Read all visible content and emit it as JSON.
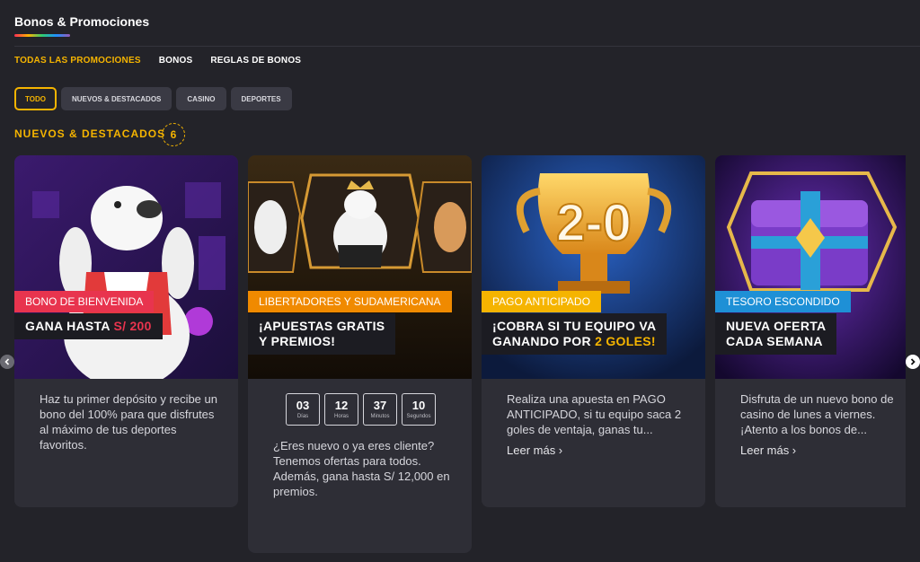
{
  "header": {
    "title": "Bonos & Promociones"
  },
  "tabs": [
    {
      "label": "TODAS LAS PROMOCIONES"
    },
    {
      "label": "BONOS"
    },
    {
      "label": "REGLAS DE BONOS"
    }
  ],
  "filters": [
    {
      "label": "TODO"
    },
    {
      "label": "NUEVOS & DESTACADOS"
    },
    {
      "label": "CASINO"
    },
    {
      "label": "DEPORTES"
    }
  ],
  "section": {
    "heading": "NUEVOS & DESTACADOS",
    "count": "6"
  },
  "cards": [
    {
      "tag": "BONO DE BIENVENIDA",
      "tag_color": "#e8344e",
      "headline_main": "GANA HASTA ",
      "headline_accent": "S/ 200",
      "description": "Haz tu primer depósito y recibe un bono del 100% para que disfrutes al máximo de tus deportes favoritos."
    },
    {
      "tag": "LIBERTADORES Y SUDAMERICANA",
      "tag_color": "#f08a00",
      "headline_line1": "¡APUESTAS GRATIS",
      "headline_line2": "Y PREMIOS!",
      "countdown": [
        {
          "value": "03",
          "label": "Días"
        },
        {
          "value": "12",
          "label": "Horas"
        },
        {
          "value": "37",
          "label": "Minutos"
        },
        {
          "value": "10",
          "label": "Segundos"
        }
      ],
      "description": "¿Eres nuevo o ya eres cliente? Tenemos ofertas para todos. Además, gana hasta S/ 12,000 en premios."
    },
    {
      "tag": "PAGO ANTICIPADO",
      "tag_color": "#f5b400",
      "headline_line1": "¡COBRA SI TU EQUIPO VA",
      "headline_line2_main": "GANANDO POR ",
      "headline_line2_accent": "2 GOLES!",
      "image_text": "2-0",
      "description": "Realiza una apuesta en PAGO ANTICIPADO, si tu equipo saca 2 goles de ventaja, ganas tu...",
      "read_more": "Leer más ›"
    },
    {
      "tag": "TESORO ESCONDIDO",
      "tag_color": "#1e90d6",
      "headline_line1": "NUEVA OFERTA",
      "headline_line2": "CADA SEMANA",
      "description": "Disfruta de un nuevo bono de casino de lunes a viernes. ¡Atento a los bonos de...",
      "read_more": "Leer más ›"
    }
  ],
  "icons": {
    "prev": "chevron-left-icon",
    "next": "chevron-right-icon"
  },
  "colors": {
    "accent": "#f5b400",
    "background": "#232329",
    "card": "#2e2e36"
  }
}
